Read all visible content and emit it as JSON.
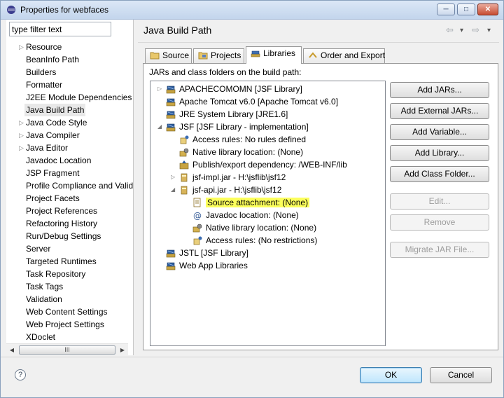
{
  "window": {
    "title": "Properties for webfaces",
    "minimize_label": "─",
    "maximize_label": "□",
    "close_label": "✕"
  },
  "filter": {
    "value": "type filter text"
  },
  "left_tree": {
    "items": [
      {
        "label": "Resource",
        "expandable": true
      },
      {
        "label": "BeanInfo Path",
        "expandable": false
      },
      {
        "label": "Builders",
        "expandable": false
      },
      {
        "label": "Formatter",
        "expandable": false
      },
      {
        "label": "J2EE Module Dependencies",
        "expandable": false
      },
      {
        "label": "Java Build Path",
        "expandable": false,
        "selected": true
      },
      {
        "label": "Java Code Style",
        "expandable": true
      },
      {
        "label": "Java Compiler",
        "expandable": true
      },
      {
        "label": "Java Editor",
        "expandable": true
      },
      {
        "label": "Javadoc Location",
        "expandable": false
      },
      {
        "label": "JSP Fragment",
        "expandable": false
      },
      {
        "label": "Profile Compliance and Valid",
        "expandable": false
      },
      {
        "label": "Project Facets",
        "expandable": false
      },
      {
        "label": "Project References",
        "expandable": false
      },
      {
        "label": "Refactoring History",
        "expandable": false
      },
      {
        "label": "Run/Debug Settings",
        "expandable": false
      },
      {
        "label": "Server",
        "expandable": false
      },
      {
        "label": "Targeted Runtimes",
        "expandable": false
      },
      {
        "label": "Task Repository",
        "expandable": false
      },
      {
        "label": "Task Tags",
        "expandable": false
      },
      {
        "label": "Validation",
        "expandable": false
      },
      {
        "label": "Web Content Settings",
        "expandable": false
      },
      {
        "label": "Web Project Settings",
        "expandable": false
      },
      {
        "label": "XDoclet",
        "expandable": false
      }
    ],
    "scroll_thumb_label": "III"
  },
  "page": {
    "title": "Java Build Path",
    "nav_back": "⇦",
    "nav_back_menu": "▾",
    "nav_forward": "⇨",
    "nav_forward_menu": "▾"
  },
  "tabs": [
    {
      "label": "Source",
      "icon": "source-folder-icon"
    },
    {
      "label": "Projects",
      "icon": "projects-icon"
    },
    {
      "label": "Libraries",
      "icon": "libraries-icon",
      "active": true
    },
    {
      "label": "Order and Export",
      "icon": "order-export-icon"
    }
  ],
  "libraries": {
    "section_label": "JARs and class folders on the build path:",
    "rows": [
      {
        "label": "APACHECOMOMN [JSF Library]",
        "icon": "library-icon",
        "level": 0,
        "expander": "▷"
      },
      {
        "label": "Apache Tomcat v6.0 [Apache Tomcat v6.0]",
        "icon": "library-icon",
        "level": 0,
        "expander": ""
      },
      {
        "label": "JRE System Library [JRE1.6]",
        "icon": "library-icon",
        "level": 0,
        "expander": ""
      },
      {
        "label": "JSF [JSF Library - implementation]",
        "icon": "library-icon",
        "level": 0,
        "expander": "◢"
      },
      {
        "label": "Access rules: No rules defined",
        "icon": "access-rules-icon",
        "level": 1,
        "expander": ""
      },
      {
        "label": "Native library location: (None)",
        "icon": "native-library-icon",
        "level": 1,
        "expander": ""
      },
      {
        "label": "Publish/export dependency: /WEB-INF/lib",
        "icon": "publish-icon",
        "level": 1,
        "expander": ""
      },
      {
        "label": "jsf-impl.jar - H:\\jsflib\\jsf12",
        "icon": "jar-icon",
        "level": 1,
        "expander": "▷"
      },
      {
        "label": "jsf-api.jar - H:\\jsflib\\jsf12",
        "icon": "jar-icon",
        "level": 1,
        "expander": "◢"
      },
      {
        "label": "Source attachment: (None)",
        "icon": "source-attachment-icon",
        "level": 2,
        "expander": "",
        "highlight": true
      },
      {
        "label": "Javadoc location: (None)",
        "icon": "javadoc-icon",
        "level": 2,
        "expander": ""
      },
      {
        "label": "Native library location: (None)",
        "icon": "native-library-icon",
        "level": 2,
        "expander": ""
      },
      {
        "label": "Access rules: (No restrictions)",
        "icon": "access-rules-icon",
        "level": 2,
        "expander": ""
      },
      {
        "label": "JSTL [JSF Library]",
        "icon": "library-icon",
        "level": 0,
        "expander": ""
      },
      {
        "label": "Web App Libraries",
        "icon": "library-icon",
        "level": 0,
        "expander": ""
      }
    ]
  },
  "side_buttons": {
    "add_jars": "Add JARs...",
    "add_external_jars": "Add External JARs...",
    "add_variable": "Add Variable...",
    "add_library": "Add Library...",
    "add_class_folder": "Add Class Folder...",
    "edit": "Edit...",
    "remove": "Remove",
    "migrate_jar": "Migrate JAR File..."
  },
  "footer": {
    "help": "?",
    "ok": "OK",
    "cancel": "Cancel"
  },
  "colors": {
    "highlight": "#fcff5c",
    "selected_bg": "#e8e8e8"
  }
}
